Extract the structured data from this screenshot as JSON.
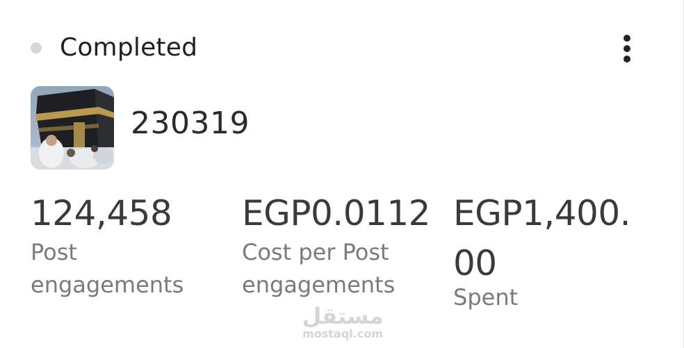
{
  "status": {
    "label": "Completed",
    "dot_color": "#d7d7d7"
  },
  "menu": {
    "icon": "more-vertical-icon"
  },
  "campaign": {
    "thumbnail": "kaaba-photo",
    "name": "230319"
  },
  "metrics": [
    {
      "value": "124,458",
      "label": "Post engagements"
    },
    {
      "value": "EGP0.0112",
      "label": "Cost per Post engagements"
    },
    {
      "value": "EGP1,400.00",
      "label": "Spent"
    }
  ],
  "watermark": {
    "arabic": "مستقل",
    "latin": "mostaql.com"
  }
}
